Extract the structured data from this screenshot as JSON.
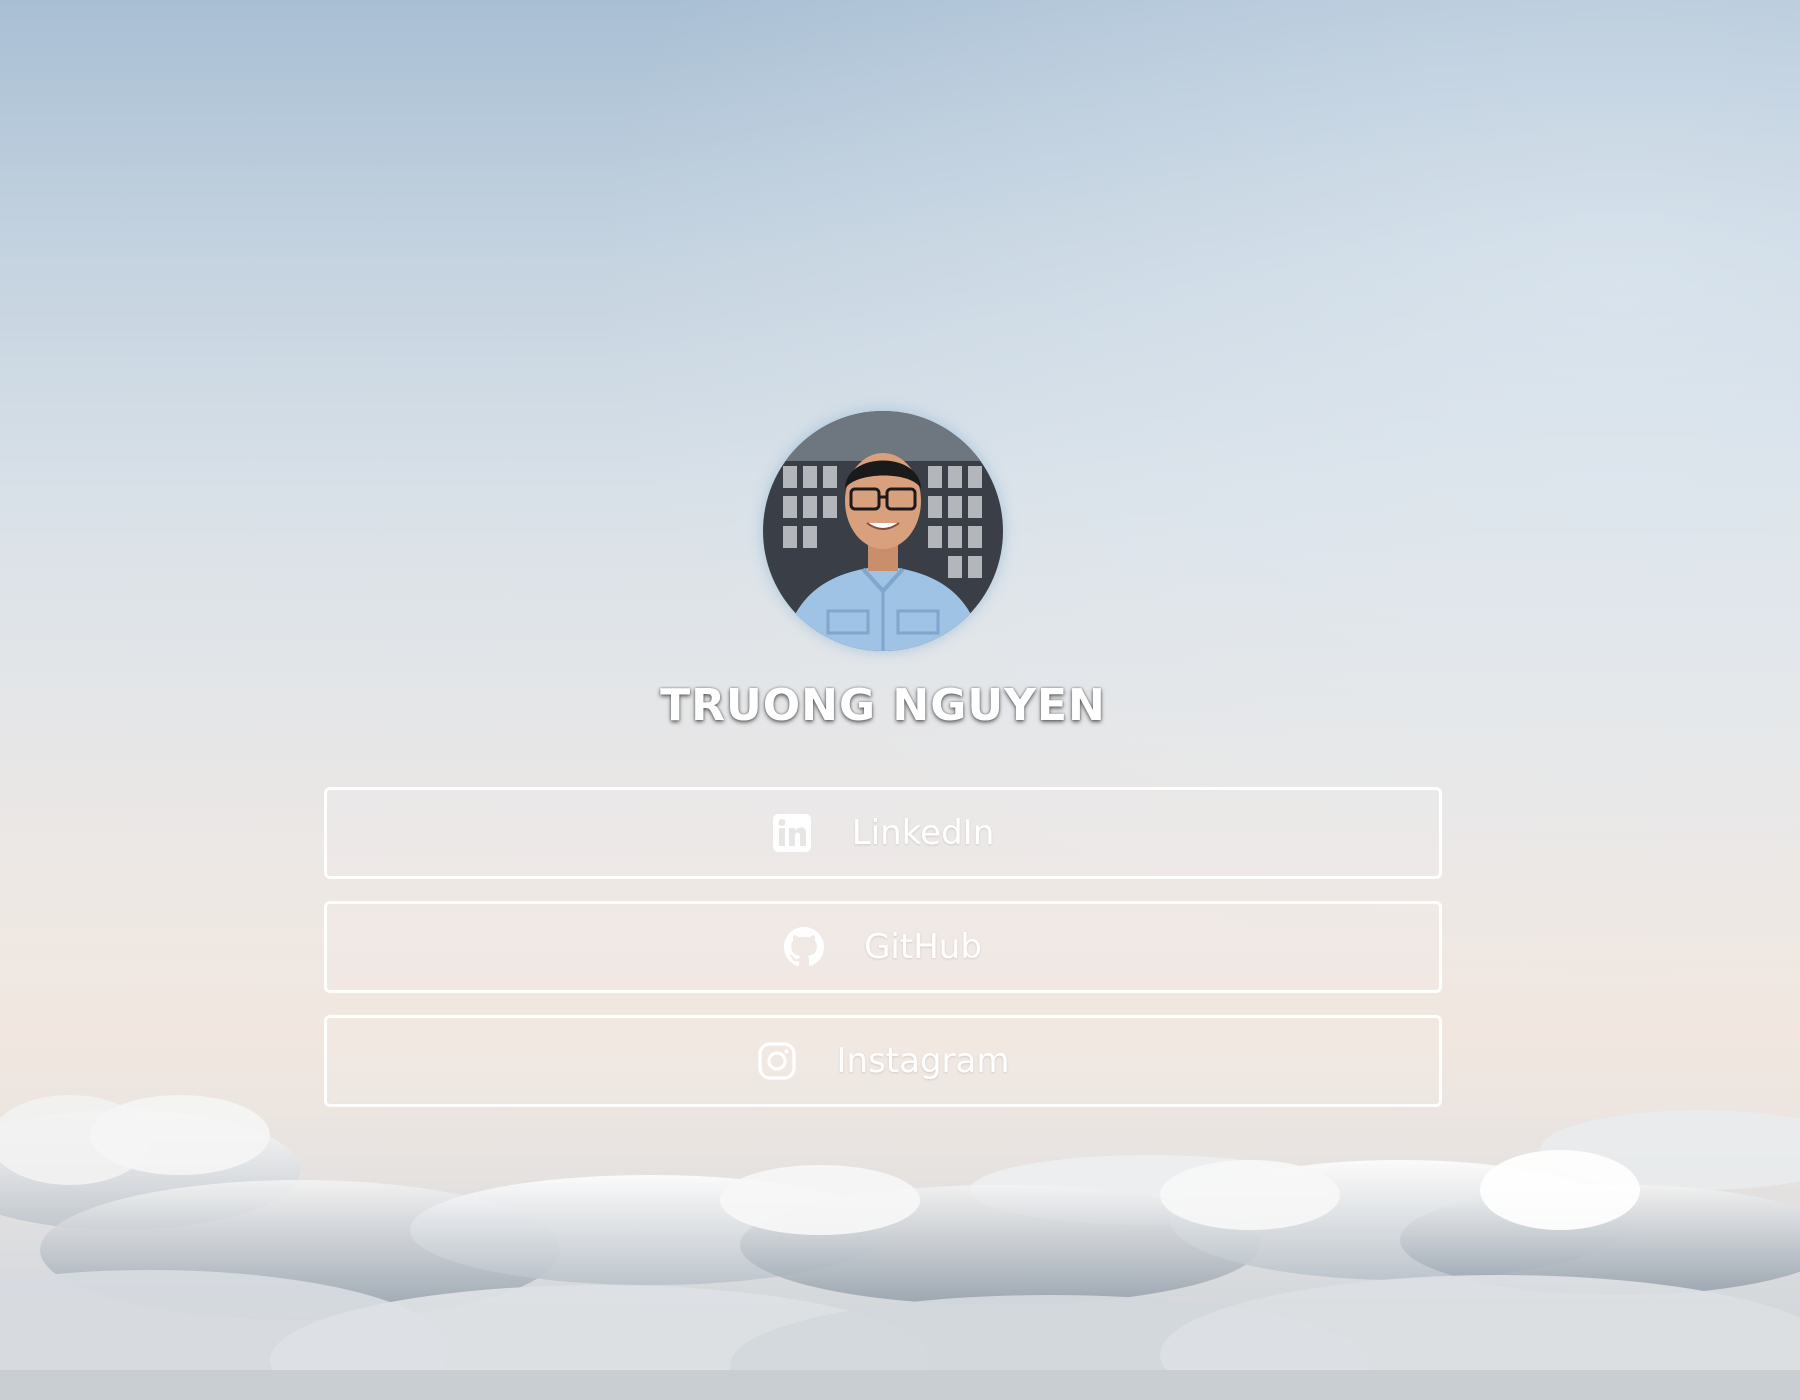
{
  "profile": {
    "name": "TRUONG NGUYEN",
    "avatar_icon": "profile-photo"
  },
  "links": [
    {
      "label": "LinkedIn",
      "icon": "linkedin-icon"
    },
    {
      "label": "GitHub",
      "icon": "github-icon"
    },
    {
      "label": "Instagram",
      "icon": "instagram-icon"
    }
  ],
  "colors": {
    "text": "#ffffff",
    "button_border": "#ffffff",
    "sky_top": "#a9bfd4",
    "sky_mid": "#e4e6e8",
    "horizon": "#f1e7e0"
  }
}
